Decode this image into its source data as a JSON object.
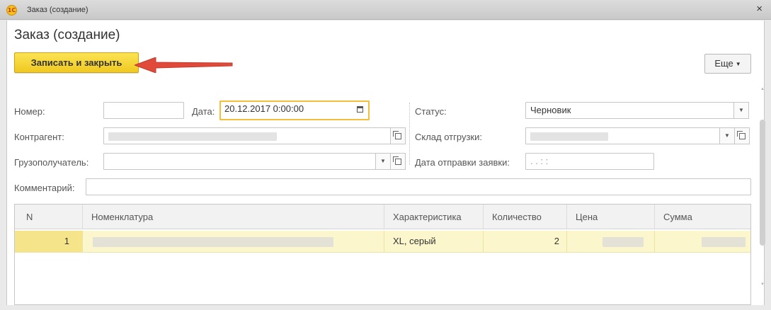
{
  "window": {
    "title": "Заказ (создание)",
    "logo": "1С",
    "close_glyph": "×"
  },
  "page_title": "Заказ (создание)",
  "toolbar": {
    "save_close_label": "Записать и закрыть",
    "more_label": "Еще",
    "accent_color": "#f4c93a",
    "arrow_color": "#e04a3a"
  },
  "fields": {
    "number_label": "Номер:",
    "number_value": "",
    "date_label": "Дата:",
    "date_value": "20.12.2017  0:00:00",
    "status_label": "Статус:",
    "status_value": "Черновик",
    "counterparty_label": "Контрагент:",
    "warehouse_label": "Склад отгрузки:",
    "consignee_label": "Грузополучатель:",
    "consignee_value": "",
    "request_date_label": "Дата отправки заявки:",
    "request_date_value": " .  .      :  :",
    "comment_label": "Комментарий:",
    "comment_value": ""
  },
  "table": {
    "columns": [
      "N",
      "Номенклатура",
      "Характеристика",
      "Количество",
      "Цена",
      "Сумма"
    ],
    "rows": [
      {
        "n": "1",
        "characteristic": "XL, серый",
        "quantity": "2"
      }
    ]
  },
  "icons": {
    "calendar": "calendar-icon",
    "dropdown": "chevron-down-icon",
    "open": "open-form-icon"
  }
}
